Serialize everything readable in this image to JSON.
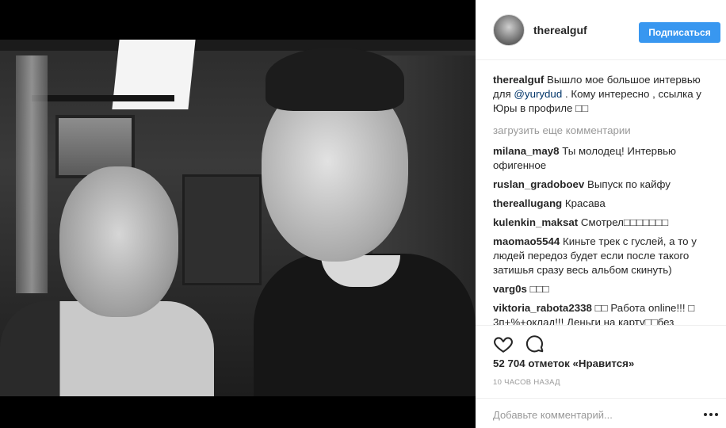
{
  "post": {
    "username": "therealguf",
    "follow_label": "Подписаться",
    "caption": {
      "user": "therealguf",
      "text_before": "Вышло мое большое интервью для",
      "mention": "@yurydud",
      "text_after": ". Кому интересно , ссылка у Юры в профиле □□"
    },
    "load_more": "загрузить еще комментарии",
    "comments": [
      {
        "user": "milana_may8",
        "text": "Ты молодец! Интервью офигенное"
      },
      {
        "user": "ruslan_gradoboev",
        "text": "Выпуск по кайфу"
      },
      {
        "user": "thereallugang",
        "text": "Красава"
      },
      {
        "user": "kulenkin_maksat",
        "text": "Смотрел□□□□□□□"
      },
      {
        "user": "maomao5544",
        "text": "Киньте трек с гуслей, а то у людей передоз будет если после такого затишья сразу весь альбом скинуть)"
      },
      {
        "user": "varg0s",
        "text": "□□□"
      },
      {
        "user": "viktoria_rabota2338",
        "text": "□□ Работа online!!! □ 3п+%+оклад!!! Деньги на карту□□без"
      }
    ],
    "likes": "52 704 отметок «Нравится»",
    "time": "10 часов назад",
    "comment_placeholder": "Добавьте комментарий..."
  },
  "icons": {
    "like": "heart-icon",
    "comment": "speech-bubble-icon",
    "more": "more-options-icon"
  },
  "colors": {
    "follow_button": "#3897f0",
    "mention": "#003569",
    "muted": "#999999"
  }
}
